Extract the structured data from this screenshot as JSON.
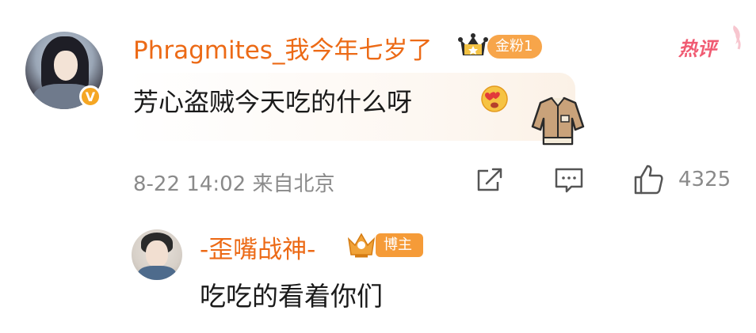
{
  "comment": {
    "username": "Phragmites_我今年七岁了",
    "badge": "金粉1",
    "hot_label": "热评",
    "text": "芳心盗贼今天吃的什么呀",
    "meta": "8-22 14:02 来自北京",
    "likes": "4325",
    "verified_icon": "V"
  },
  "reply": {
    "username": "-歪嘴战神-",
    "badge": "博主",
    "text": "吃吃的看着你们"
  },
  "colors": {
    "username": "#ec6a16",
    "fan_badge": "#f7a54a",
    "hot": "#f05b72",
    "meta": "#8a8a8a"
  }
}
